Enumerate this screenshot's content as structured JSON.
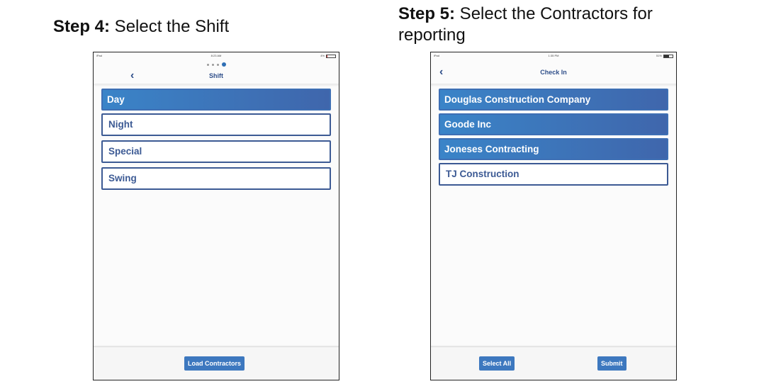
{
  "step4": {
    "label": "Step 4:",
    "text": " Select the Shift",
    "device": {
      "status": {
        "carrier": "iPad",
        "time": "8:23 AM",
        "battery": "4%"
      },
      "nav": {
        "title": "Shift"
      },
      "items": [
        {
          "label": "Day",
          "selected": true
        },
        {
          "label": "Night",
          "selected": false
        },
        {
          "label": "Special",
          "selected": false
        },
        {
          "label": "Swing",
          "selected": false
        }
      ],
      "footer": {
        "load_contractors": "Load Contractors"
      }
    }
  },
  "step5": {
    "label": "Step 5:",
    "text": " Select the Contractors for reporting",
    "device": {
      "status": {
        "carrier": "iPad",
        "time": "1:35 PM",
        "battery": "51%"
      },
      "nav": {
        "title": "Check In"
      },
      "items": [
        {
          "label": "Douglas Construction Company",
          "selected": true
        },
        {
          "label": "Goode Inc",
          "selected": true
        },
        {
          "label": "Joneses Contracting",
          "selected": true
        },
        {
          "label": "TJ Construction",
          "selected": false
        }
      ],
      "footer": {
        "select_all": "Select All",
        "submit": "Submit"
      }
    }
  }
}
